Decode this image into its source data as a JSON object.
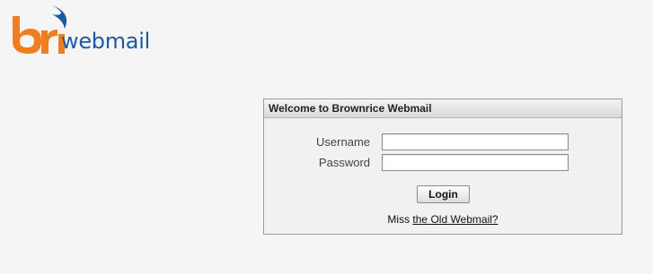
{
  "logo": {
    "mark_text": "bri",
    "wordmark": "webmail",
    "colors": {
      "orange": "#f07d1e",
      "blue": "#1e5aa0"
    }
  },
  "login": {
    "header_title": "Welcome to Brownrice Webmail",
    "username_label": "Username",
    "username_value": "",
    "password_label": "Password",
    "password_value": "",
    "login_button_label": "Login",
    "old_webmail_prefix": "Miss",
    "old_webmail_link": "the Old Webmail?"
  }
}
